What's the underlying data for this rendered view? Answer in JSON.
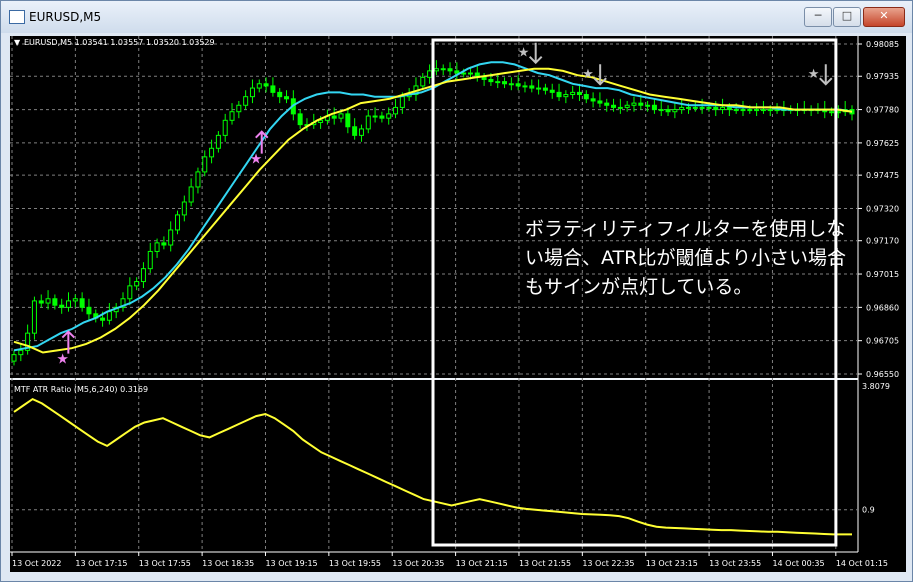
{
  "window": {
    "title": "EURUSD,M5",
    "buttons": {
      "minimize": "─",
      "maximize": "□",
      "close": "✕"
    }
  },
  "main_header": "EURUSD,M5  1.03541 1.03557 1.03520 1.03529",
  "indicator_header": "MTF ATR Ratio  (M5,6,240) 0.3169",
  "annotation": "ボラティリティフィルターを使用しない場合、ATR比が閾値より小さい場合もサインが点灯している。",
  "chart_data": [
    {
      "type": "line",
      "title": "EURUSD,M5",
      "ohlc_header": [
        1.03541,
        1.03557,
        1.0352,
        1.03529
      ],
      "y_ticks": [
        "0.98085",
        "0.97935",
        "0.97780",
        "0.97625",
        "0.97475",
        "0.97320",
        "0.97170",
        "0.97015",
        "0.96860",
        "0.96705",
        "0.96550"
      ],
      "ylim": [
        0.9655,
        0.98085
      ],
      "x_ticks": [
        "13 Oct 2022",
        "13 Oct 17:15",
        "13 Oct 17:55",
        "13 Oct 18:35",
        "13 Oct 19:15",
        "13 Oct 19:55",
        "13 Oct 20:35",
        "13 Oct 21:15",
        "13 Oct 21:55",
        "13 Oct 22:35",
        "13 Oct 23:15",
        "13 Oct 23:55",
        "14 Oct 00:35",
        "14 Oct 01:15"
      ],
      "grid": true,
      "colors": {
        "background": "#000000",
        "candles": "#00ff00",
        "fast_ma": "#33d6f2",
        "slow_ma": "#ffff33",
        "buy_signal": "#ee82ee",
        "sell_signal": "#c0c0c0",
        "grid": "#7f7f7f",
        "highlight_box": "#ffffff"
      },
      "close": [
        0.9664,
        0.9666,
        0.9674,
        0.9689,
        0.9688,
        0.969,
        0.9687,
        0.9686,
        0.9689,
        0.969,
        0.9686,
        0.9683,
        0.9681,
        0.968,
        0.9684,
        0.9686,
        0.969,
        0.9696,
        0.9698,
        0.9704,
        0.9712,
        0.9716,
        0.9715,
        0.9722,
        0.9729,
        0.9735,
        0.9742,
        0.9749,
        0.9756,
        0.976,
        0.9766,
        0.9773,
        0.9777,
        0.978,
        0.9784,
        0.9788,
        0.979,
        0.9789,
        0.9786,
        0.9784,
        0.9783,
        0.9776,
        0.9771,
        0.9771,
        0.9772,
        0.9773,
        0.9775,
        0.9774,
        0.9776,
        0.977,
        0.9766,
        0.9769,
        0.9775,
        0.9775,
        0.9774,
        0.9776,
        0.9779,
        0.9784,
        0.9785,
        0.9789,
        0.9793,
        0.9796,
        0.9797,
        0.9797,
        0.9796,
        0.9795,
        0.9795,
        0.9795,
        0.9793,
        0.9792,
        0.9791,
        0.9791,
        0.979,
        0.979,
        0.9789,
        0.9789,
        0.9788,
        0.9788,
        0.9787,
        0.9786,
        0.9784,
        0.9785,
        0.9786,
        0.9785,
        0.9783,
        0.9782,
        0.9781,
        0.978,
        0.9779,
        0.9779,
        0.978,
        0.9781,
        0.978,
        0.978,
        0.9778,
        0.9778,
        0.9777,
        0.9778,
        0.9779,
        0.9779,
        0.9779,
        0.9779,
        0.9779,
        0.9778,
        0.9779,
        0.9778,
        0.9778,
        0.9778,
        0.9778,
        0.9778,
        0.9778,
        0.9778,
        0.9778,
        0.9778,
        0.9778,
        0.9778,
        0.9778,
        0.9778,
        0.9778,
        0.9777,
        0.9777,
        0.9777,
        0.9778,
        0.9776
      ],
      "fast_ma": [
        0.9666,
        0.9667,
        0.9668,
        0.9671,
        0.9674,
        0.9676,
        0.9679,
        0.9681,
        0.9684,
        0.9686,
        0.9688,
        0.9691,
        0.9695,
        0.97,
        0.9706,
        0.9713,
        0.9721,
        0.9729,
        0.9737,
        0.9745,
        0.9753,
        0.9761,
        0.9769,
        0.9775,
        0.978,
        0.9783,
        0.9785,
        0.9786,
        0.9786,
        0.9785,
        0.9785,
        0.9784,
        0.9784,
        0.9784,
        0.9785,
        0.9786,
        0.9788,
        0.9791,
        0.9794,
        0.9797,
        0.9799,
        0.98,
        0.98,
        0.9799,
        0.9797,
        0.9795,
        0.9794,
        0.9792,
        0.979,
        0.9789,
        0.9788,
        0.9788,
        0.9787,
        0.9785,
        0.9784,
        0.9783,
        0.9782,
        0.9781,
        0.978,
        0.978,
        0.978,
        0.978,
        0.9779,
        0.9779,
        0.9779,
        0.9779,
        0.9778,
        0.9778,
        0.9778,
        0.9778,
        0.9778,
        0.9778,
        0.9777
      ],
      "slow_ma": [
        0.967,
        0.9668,
        0.9665,
        0.9666,
        0.9667,
        0.9669,
        0.9672,
        0.9676,
        0.9681,
        0.9687,
        0.9694,
        0.9702,
        0.971,
        0.9718,
        0.9726,
        0.9734,
        0.9742,
        0.975,
        0.9757,
        0.9764,
        0.9769,
        0.9773,
        0.9776,
        0.9778,
        0.9781,
        0.9782,
        0.9783,
        0.9785,
        0.9787,
        0.9789,
        0.9791,
        0.9792,
        0.9793,
        0.9794,
        0.9795,
        0.9796,
        0.9797,
        0.9797,
        0.9796,
        0.9794,
        0.9793,
        0.9791,
        0.9789,
        0.9787,
        0.9785,
        0.9784,
        0.9783,
        0.9782,
        0.9781,
        0.978,
        0.978,
        0.9779,
        0.9779,
        0.9779,
        0.9778,
        0.9778,
        0.9778,
        0.9778,
        0.9777
      ],
      "signals": [
        {
          "type": "buy",
          "x": "13 Oct 17:05",
          "y": 0.9671
        },
        {
          "type": "buy",
          "x": "13 Oct 19:05",
          "y": 0.9764
        },
        {
          "type": "sell",
          "x": "13 Oct 21:55",
          "y": 0.9797
        },
        {
          "type": "sell",
          "x": "13 Oct 22:35",
          "y": 0.9787
        },
        {
          "type": "sell",
          "x": "14 Oct 00:55",
          "y": 0.9787
        }
      ],
      "highlight_box": {
        "x_from": "13 Oct 20:55",
        "x_to": "14 Oct 01:05"
      }
    },
    {
      "type": "line",
      "title": "MTF ATR Ratio  (M5,6,240) 0.3169",
      "y_ticks": [
        "3.8079",
        "0.9"
      ],
      "ylim": [
        0,
        3.8079
      ],
      "series": [
        {
          "values": [
            3.2,
            3.35,
            3.5,
            3.4,
            3.25,
            3.1,
            2.95,
            2.8,
            2.65,
            2.5,
            2.4,
            2.55,
            2.7,
            2.85,
            2.95,
            3.0,
            3.05,
            2.95,
            2.85,
            2.75,
            2.65,
            2.6,
            2.7,
            2.8,
            2.9,
            3.0,
            3.1,
            3.15,
            3.05,
            2.9,
            2.75,
            2.55,
            2.4,
            2.25,
            2.15,
            2.05,
            1.95,
            1.85,
            1.75,
            1.65,
            1.55,
            1.45,
            1.35,
            1.25,
            1.15,
            1.1,
            1.05,
            1.0,
            1.05,
            1.1,
            1.15,
            1.1,
            1.05,
            1.0,
            0.95,
            0.92,
            0.9,
            0.88,
            0.86,
            0.84,
            0.82,
            0.8,
            0.79,
            0.78,
            0.77,
            0.75,
            0.7,
            0.62,
            0.55,
            0.5,
            0.48,
            0.47,
            0.46,
            0.45,
            0.44,
            0.43,
            0.42,
            0.42,
            0.41,
            0.4,
            0.39,
            0.38,
            0.38,
            0.37,
            0.36,
            0.35,
            0.34,
            0.33,
            0.32,
            0.32,
            0.32
          ]
        }
      ]
    }
  ]
}
